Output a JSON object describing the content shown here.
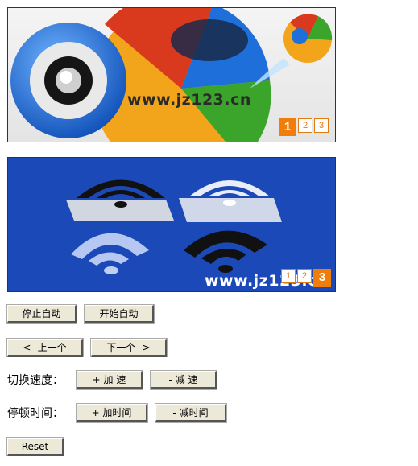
{
  "banners": [
    {
      "text": "www.jz123.cn",
      "pages": [
        "1",
        "2",
        "3"
      ],
      "active": "1",
      "colors": {
        "bg": "#eeeeee",
        "blue": "#1e6fd9",
        "red": "#d93a1e",
        "yellow": "#f2a51a",
        "green": "#3aa52a"
      }
    },
    {
      "text": "www.jz123.cn",
      "pages": [
        "1",
        "2",
        "3"
      ],
      "active": "3",
      "colors": {
        "bg": "#1c49b8",
        "icon_dark": "#111111",
        "icon_light": "#f0f0f0"
      }
    }
  ],
  "controls": {
    "stop_auto": "停止自动",
    "start_auto": "开始自动",
    "prev": "<- 上一个",
    "next": "下一个 ->",
    "speed_label": "切换速度：",
    "speed_up": "+ 加 速",
    "speed_down": "- 减 速",
    "pause_label": "停顿时间：",
    "pause_up": "+ 加时间",
    "pause_down": "- 减时间",
    "reset": "Reset"
  }
}
